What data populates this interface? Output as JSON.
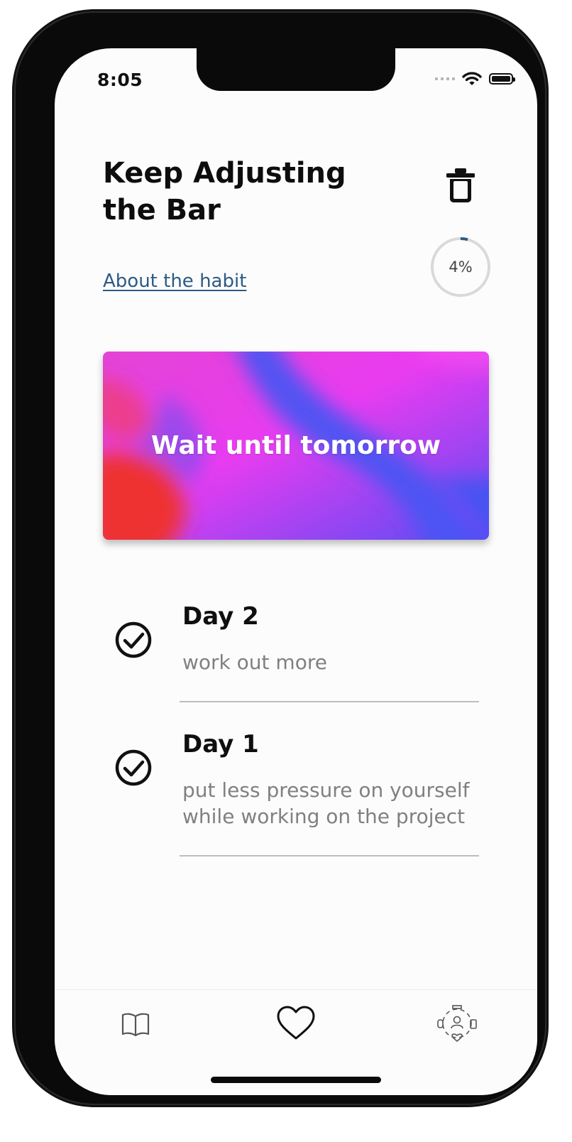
{
  "status_bar": {
    "time": "8:05"
  },
  "habit": {
    "title": "Keep Adjusting the Bar",
    "about_link": "About the habit",
    "progress_percent": 4,
    "progress_label": "4%"
  },
  "banner": {
    "text": "Wait until tomorrow"
  },
  "entries": [
    {
      "day": "Day 2",
      "note": "work out more",
      "completed": true
    },
    {
      "day": "Day 1",
      "note": "put less pressure on yourself while working on the project",
      "completed": true
    }
  ],
  "tab_bar": {
    "tabs": [
      {
        "icon": "book-icon",
        "active": false
      },
      {
        "icon": "heart-icon",
        "active": true
      },
      {
        "icon": "wellbeing-icon",
        "active": false
      }
    ]
  },
  "colors": {
    "link": "#2c5b85",
    "progress_arc": "#2c5b85",
    "banner_gradient": [
      "#ee3030",
      "#e93ef0",
      "#3f54f2"
    ]
  }
}
